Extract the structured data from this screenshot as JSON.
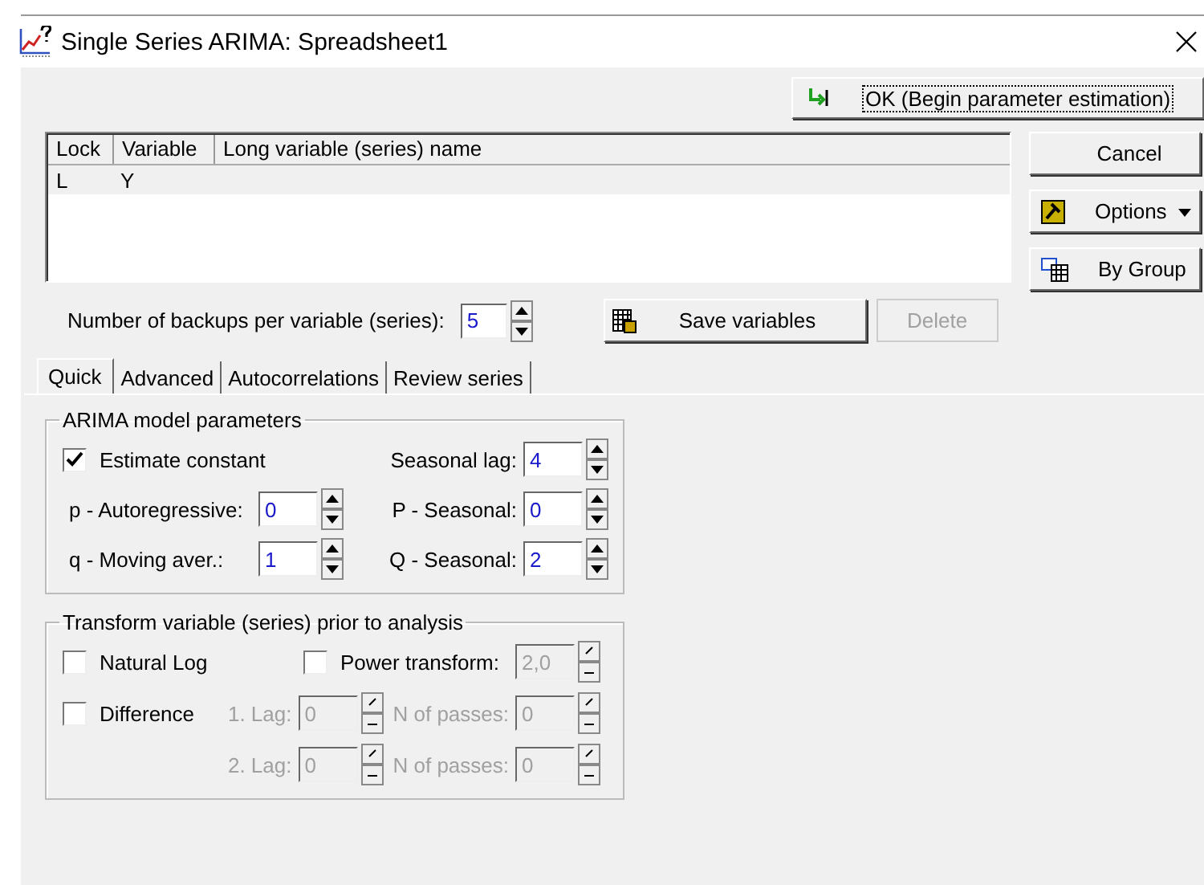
{
  "window": {
    "title": "Single Series ARIMA: Spreadsheet1"
  },
  "ok_button": {
    "label": "OK (Begin parameter estimation)"
  },
  "table": {
    "columns": [
      "Lock",
      "Variable",
      "Long variable (series) name"
    ],
    "rows": [
      {
        "cells": [
          "L",
          "Y",
          ""
        ],
        "selected": true
      }
    ]
  },
  "side_buttons": [
    {
      "label": "Cancel",
      "kind": "plain"
    },
    {
      "label": "Options",
      "kind": "menu"
    },
    {
      "label": "By Group",
      "kind": "group"
    }
  ],
  "backups": {
    "label": "Number of backups per variable (series):",
    "value": "5"
  },
  "save_button": {
    "label": "Save variables",
    "disabled": false
  },
  "delete_button": {
    "label": "Delete",
    "disabled": true
  },
  "tabs": [
    {
      "label": "Quick",
      "selected": true
    },
    {
      "label": "Advanced",
      "selected": false
    },
    {
      "label": "Autocorrelations",
      "selected": false
    },
    {
      "label": "Review series",
      "selected": false
    }
  ],
  "arima": {
    "title": "ARIMA model parameters",
    "estimate_constant": {
      "label": "Estimate constant",
      "checked": true
    },
    "seasonal_lag": {
      "label": "Seasonal lag:",
      "value": "4"
    },
    "rows": [
      {
        "label": "p - Autoregressive:",
        "value": "0",
        "seasonal_label": "P - Seasonal:",
        "seasonal_value": "0"
      },
      {
        "label": "q - Moving aver.:",
        "value": "1",
        "seasonal_label": "Q - Seasonal:",
        "seasonal_value": "2"
      }
    ]
  },
  "transform": {
    "title": "Transform variable (series) prior to analysis",
    "natural_log": {
      "label": "Natural Log",
      "checked": false
    },
    "power": {
      "label": "Power transform:",
      "checked": false,
      "value": "2,0",
      "disabled": true
    },
    "difference": {
      "label": "Difference",
      "checked": false
    },
    "lags": [
      {
        "lag_label": "1. Lag:",
        "lag_value": "0",
        "passes_label": "N of passes:",
        "passes_value": "0",
        "disabled": true
      },
      {
        "lag_label": "2. Lag:",
        "lag_value": "0",
        "passes_label": "N of passes:",
        "passes_value": "0",
        "disabled": true
      }
    ]
  }
}
